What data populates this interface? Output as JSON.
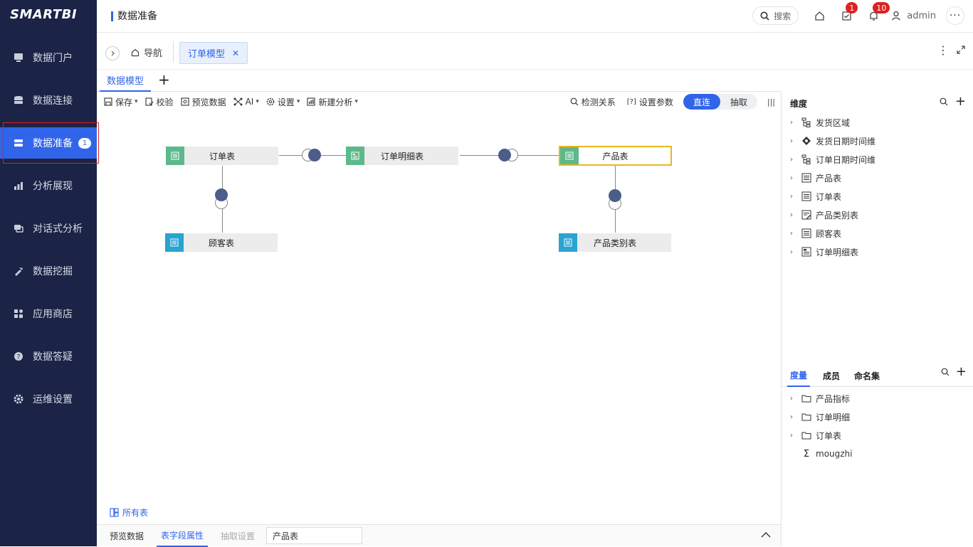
{
  "brand": "SMARTBI",
  "sidebar": {
    "items": [
      {
        "label": "数据门户"
      },
      {
        "label": "数据连接"
      },
      {
        "label": "数据准备",
        "badge": "1"
      },
      {
        "label": "分析展现"
      },
      {
        "label": "对话式分析"
      },
      {
        "label": "数据挖掘"
      },
      {
        "label": "应用商店"
      },
      {
        "label": "数据答疑"
      },
      {
        "label": "运维设置"
      }
    ]
  },
  "header": {
    "title": "数据准备",
    "search_label": "搜索",
    "task_badge": "1",
    "notify_badge": "10",
    "username": "admin"
  },
  "tabs": {
    "home_label": "导航",
    "doc_tab_label": "订单模型"
  },
  "subtabs": {
    "active": "数据模型"
  },
  "toolbar": {
    "save": "保存",
    "validate": "校验",
    "preview": "预览数据",
    "ai": "AI",
    "settings": "设置",
    "new_analysis": "新建分析",
    "detect": "检测关系",
    "params": "设置参数",
    "mode_direct": "直连",
    "mode_extract": "抽取"
  },
  "canvas": {
    "nodes": {
      "orders": "订单表",
      "order_detail": "订单明细表",
      "product": "产品表",
      "customer": "顾客表",
      "category": "产品类别表"
    },
    "all_tables": "所有表"
  },
  "bottom": {
    "preview": "预览数据",
    "field_props": "表字段属性",
    "extract_settings": "抽取设置",
    "table_value": "产品表"
  },
  "dimensions": {
    "title": "维度",
    "items": [
      {
        "label": "发货区域",
        "icon": "hierarchy-icon"
      },
      {
        "label": "发货日期时间维",
        "icon": "date-dimension-icon"
      },
      {
        "label": "订单日期时间维",
        "icon": "hierarchy-icon"
      },
      {
        "label": "产品表",
        "icon": "table-icon"
      },
      {
        "label": "订单表",
        "icon": "table-icon"
      },
      {
        "label": "产品类别表",
        "icon": "table-edit-icon"
      },
      {
        "label": "顾客表",
        "icon": "table-icon"
      },
      {
        "label": "订单明细表",
        "icon": "table-icon"
      }
    ]
  },
  "measures": {
    "tabs": [
      "度量",
      "成员",
      "命名集"
    ],
    "items": [
      {
        "label": "产品指标",
        "icon": "folder-icon"
      },
      {
        "label": "订单明细",
        "icon": "folder-icon"
      },
      {
        "label": "订单表",
        "icon": "folder-icon"
      },
      {
        "label": "mougzhi",
        "icon": "sigma-icon"
      }
    ]
  },
  "colors": {
    "sidebar_bg": "#1b2346",
    "accent": "#3165e9",
    "node_icon_green": "#5cb98b",
    "node_icon_blue": "#2aa3cf",
    "join_dot": "#4c5d8a",
    "selected_border": "#e8b820"
  }
}
